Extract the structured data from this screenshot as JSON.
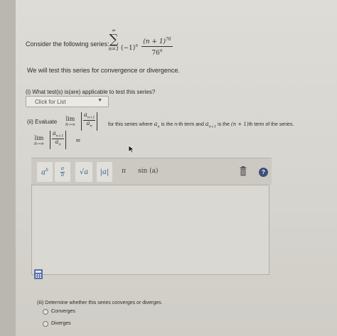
{
  "intro": {
    "text": "Consider the following series:",
    "sum_upper": "∞",
    "sum_lower": "n=1",
    "sign_factor": "(−1)",
    "sign_exponent": "n",
    "term_numerator_base": "(n + 1)",
    "term_numerator_exponent": "76",
    "term_denominator_base": "76",
    "term_denominator_exponent": "n"
  },
  "instruction": "We will test this series for convergence or divergence.",
  "part1": {
    "question": "(i) What test(s) is(are) applicable to test this series?",
    "dropdown_value": "Click for List",
    "dropdown_caret": "▼"
  },
  "part2": {
    "label": "(ii) Evaluate",
    "lim": "lim",
    "lim_sub": "n→∞",
    "ratio_num": "a",
    "ratio_num_sub": "n+1",
    "ratio_den": "a",
    "ratio_den_sub": "n",
    "explain_1": "for this series where",
    "a_n": "a",
    "a_n_sub": "n",
    "explain_2": "is the n-th term and",
    "a_n1": "a",
    "a_n1_sub": "n+1",
    "explain_3": "is the",
    "nplus1": "(n + 1)",
    "explain_4": "th term of the series.",
    "second_lim": "lim",
    "second_lim_sub": "n→∞",
    "equals": "="
  },
  "toolbar": {
    "power": "b",
    "power_base": "a",
    "fraction_top": "a",
    "fraction_bottom": "b",
    "sqrt": "√a",
    "abs": "|a|",
    "pi": "π",
    "sin": "sin (a)",
    "help": "?"
  },
  "part3": {
    "question": "(iii) Determine whether this series converges or diverges.",
    "options": [
      "Converges",
      "Diverges"
    ]
  },
  "colors": {
    "accent": "#3a5f8a",
    "help_button": "#3d4f7a",
    "calculator_icon": "#5670a6"
  }
}
